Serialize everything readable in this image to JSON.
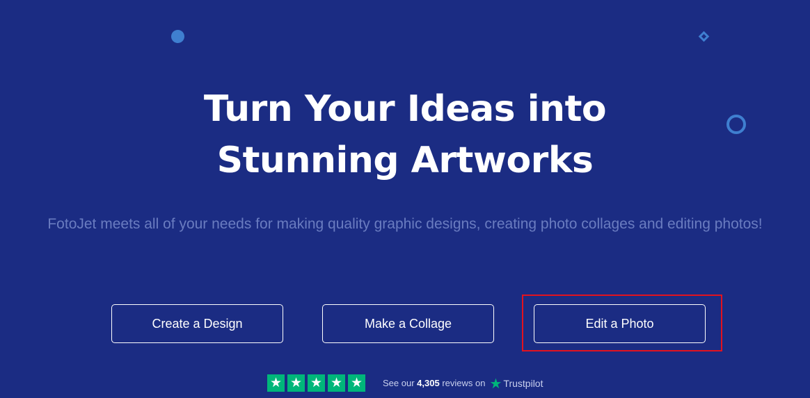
{
  "hero": {
    "title_line1": "Turn Your Ideas into",
    "title_line2": "Stunning Artworks",
    "subtitle": "FotoJet meets all of your needs for making quality graphic designs, creating photo collages and editing photos!"
  },
  "actions": {
    "create_design": "Create a Design",
    "make_collage": "Make a Collage",
    "edit_photo": "Edit a Photo"
  },
  "reviews": {
    "rating_stars": 5,
    "prefix": "See our",
    "count": "4,305",
    "suffix": "reviews on",
    "platform": "Trustpilot"
  },
  "colors": {
    "background": "#1b2c83",
    "decoration": "#3f7fd0",
    "highlight": "#e3121e",
    "trustpilot_green": "#00b67a"
  },
  "icons": {
    "star": "star-icon",
    "trustpilot": "trustpilot-star-icon"
  }
}
